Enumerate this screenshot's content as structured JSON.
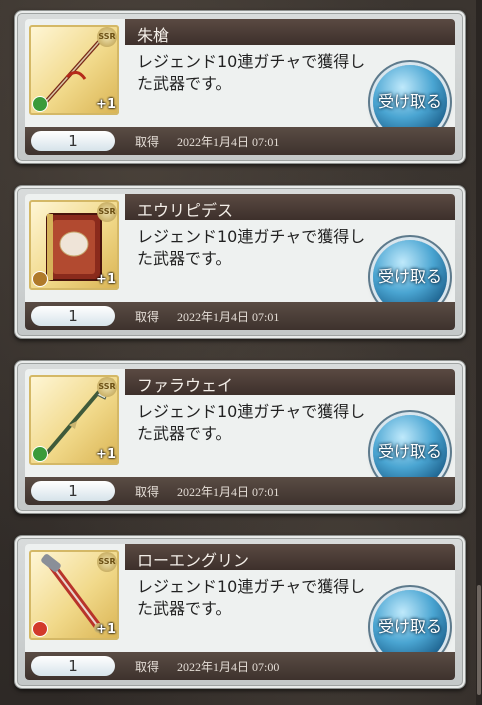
{
  "items": [
    {
      "name": "朱槍",
      "description": "レジェンド10連ガチャで獲得した武器です。",
      "rarity": "SSR",
      "plus": "+1",
      "quantity": "1",
      "acquired_label": "取得",
      "acquired_at": "2022年1月4日 07:01",
      "receive_label": "受け取る",
      "element_color": "#3a9b3a"
    },
    {
      "name": "エウリピデス",
      "description": "レジェンド10連ガチャで獲得した武器です。",
      "rarity": "SSR",
      "plus": "+1",
      "quantity": "1",
      "acquired_label": "取得",
      "acquired_at": "2022年1月4日 07:01",
      "receive_label": "受け取る",
      "element_color": "#b07a2a"
    },
    {
      "name": "ファラウェイ",
      "description": "レジェンド10連ガチャで獲得した武器です。",
      "rarity": "SSR",
      "plus": "+1",
      "quantity": "1",
      "acquired_label": "取得",
      "acquired_at": "2022年1月4日 07:01",
      "receive_label": "受け取る",
      "element_color": "#3a9b3a"
    },
    {
      "name": "ローエングリン",
      "description": "レジェンド10連ガチャで獲得した武器です。",
      "rarity": "SSR",
      "plus": "+1",
      "quantity": "1",
      "acquired_label": "取得",
      "acquired_at": "2022年1月4日 07:00",
      "receive_label": "受け取る",
      "element_color": "#d23a2a"
    }
  ]
}
